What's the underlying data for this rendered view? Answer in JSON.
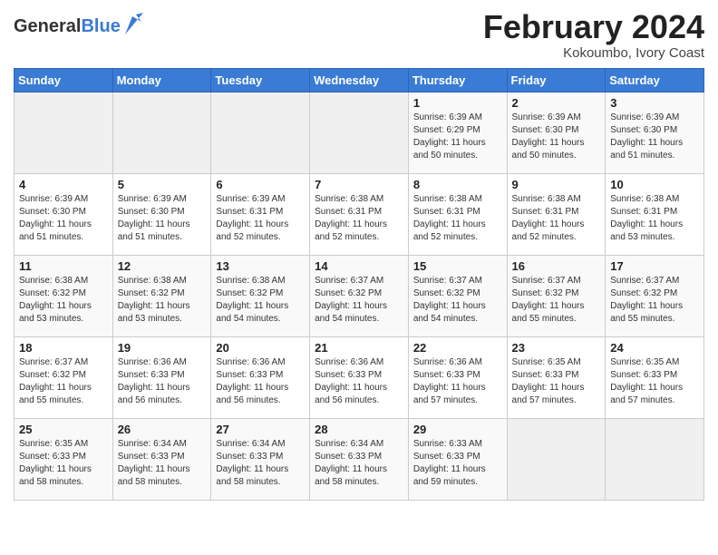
{
  "header": {
    "logo_general": "General",
    "logo_blue": "Blue",
    "title": "February 2024",
    "subtitle": "Kokoumbo, Ivory Coast"
  },
  "days_of_week": [
    "Sunday",
    "Monday",
    "Tuesday",
    "Wednesday",
    "Thursday",
    "Friday",
    "Saturday"
  ],
  "weeks": [
    [
      {
        "day": "",
        "info": ""
      },
      {
        "day": "",
        "info": ""
      },
      {
        "day": "",
        "info": ""
      },
      {
        "day": "",
        "info": ""
      },
      {
        "day": "1",
        "info": "Sunrise: 6:39 AM\nSunset: 6:29 PM\nDaylight: 11 hours and 50 minutes."
      },
      {
        "day": "2",
        "info": "Sunrise: 6:39 AM\nSunset: 6:30 PM\nDaylight: 11 hours and 50 minutes."
      },
      {
        "day": "3",
        "info": "Sunrise: 6:39 AM\nSunset: 6:30 PM\nDaylight: 11 hours and 51 minutes."
      }
    ],
    [
      {
        "day": "4",
        "info": "Sunrise: 6:39 AM\nSunset: 6:30 PM\nDaylight: 11 hours and 51 minutes."
      },
      {
        "day": "5",
        "info": "Sunrise: 6:39 AM\nSunset: 6:30 PM\nDaylight: 11 hours and 51 minutes."
      },
      {
        "day": "6",
        "info": "Sunrise: 6:39 AM\nSunset: 6:31 PM\nDaylight: 11 hours and 52 minutes."
      },
      {
        "day": "7",
        "info": "Sunrise: 6:38 AM\nSunset: 6:31 PM\nDaylight: 11 hours and 52 minutes."
      },
      {
        "day": "8",
        "info": "Sunrise: 6:38 AM\nSunset: 6:31 PM\nDaylight: 11 hours and 52 minutes."
      },
      {
        "day": "9",
        "info": "Sunrise: 6:38 AM\nSunset: 6:31 PM\nDaylight: 11 hours and 52 minutes."
      },
      {
        "day": "10",
        "info": "Sunrise: 6:38 AM\nSunset: 6:31 PM\nDaylight: 11 hours and 53 minutes."
      }
    ],
    [
      {
        "day": "11",
        "info": "Sunrise: 6:38 AM\nSunset: 6:32 PM\nDaylight: 11 hours and 53 minutes."
      },
      {
        "day": "12",
        "info": "Sunrise: 6:38 AM\nSunset: 6:32 PM\nDaylight: 11 hours and 53 minutes."
      },
      {
        "day": "13",
        "info": "Sunrise: 6:38 AM\nSunset: 6:32 PM\nDaylight: 11 hours and 54 minutes."
      },
      {
        "day": "14",
        "info": "Sunrise: 6:37 AM\nSunset: 6:32 PM\nDaylight: 11 hours and 54 minutes."
      },
      {
        "day": "15",
        "info": "Sunrise: 6:37 AM\nSunset: 6:32 PM\nDaylight: 11 hours and 54 minutes."
      },
      {
        "day": "16",
        "info": "Sunrise: 6:37 AM\nSunset: 6:32 PM\nDaylight: 11 hours and 55 minutes."
      },
      {
        "day": "17",
        "info": "Sunrise: 6:37 AM\nSunset: 6:32 PM\nDaylight: 11 hours and 55 minutes."
      }
    ],
    [
      {
        "day": "18",
        "info": "Sunrise: 6:37 AM\nSunset: 6:32 PM\nDaylight: 11 hours and 55 minutes."
      },
      {
        "day": "19",
        "info": "Sunrise: 6:36 AM\nSunset: 6:33 PM\nDaylight: 11 hours and 56 minutes."
      },
      {
        "day": "20",
        "info": "Sunrise: 6:36 AM\nSunset: 6:33 PM\nDaylight: 11 hours and 56 minutes."
      },
      {
        "day": "21",
        "info": "Sunrise: 6:36 AM\nSunset: 6:33 PM\nDaylight: 11 hours and 56 minutes."
      },
      {
        "day": "22",
        "info": "Sunrise: 6:36 AM\nSunset: 6:33 PM\nDaylight: 11 hours and 57 minutes."
      },
      {
        "day": "23",
        "info": "Sunrise: 6:35 AM\nSunset: 6:33 PM\nDaylight: 11 hours and 57 minutes."
      },
      {
        "day": "24",
        "info": "Sunrise: 6:35 AM\nSunset: 6:33 PM\nDaylight: 11 hours and 57 minutes."
      }
    ],
    [
      {
        "day": "25",
        "info": "Sunrise: 6:35 AM\nSunset: 6:33 PM\nDaylight: 11 hours and 58 minutes."
      },
      {
        "day": "26",
        "info": "Sunrise: 6:34 AM\nSunset: 6:33 PM\nDaylight: 11 hours and 58 minutes."
      },
      {
        "day": "27",
        "info": "Sunrise: 6:34 AM\nSunset: 6:33 PM\nDaylight: 11 hours and 58 minutes."
      },
      {
        "day": "28",
        "info": "Sunrise: 6:34 AM\nSunset: 6:33 PM\nDaylight: 11 hours and 58 minutes."
      },
      {
        "day": "29",
        "info": "Sunrise: 6:33 AM\nSunset: 6:33 PM\nDaylight: 11 hours and 59 minutes."
      },
      {
        "day": "",
        "info": ""
      },
      {
        "day": "",
        "info": ""
      }
    ]
  ]
}
